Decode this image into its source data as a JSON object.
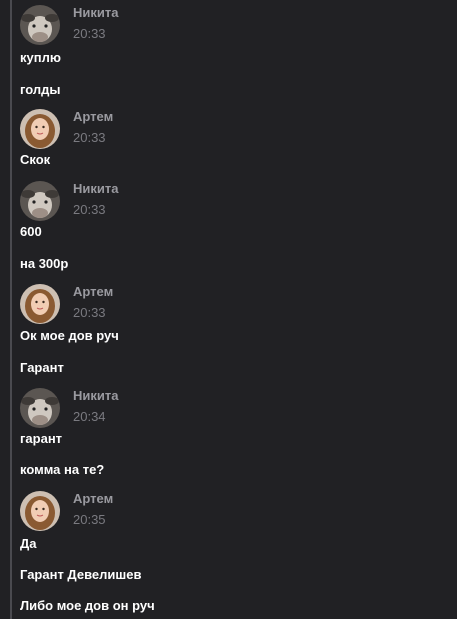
{
  "messages": [
    {
      "author": "Никита",
      "time": "20:33",
      "avatar": "cow-avatar",
      "lines": [
        "куплю",
        "голды"
      ]
    },
    {
      "author": "Артем",
      "time": "20:33",
      "avatar": "girl-avatar",
      "lines": [
        "Скок"
      ]
    },
    {
      "author": "Никита",
      "time": "20:33",
      "avatar": "cow-avatar",
      "lines": [
        "600",
        "на 300р"
      ]
    },
    {
      "author": "Артем",
      "time": "20:33",
      "avatar": "girl-avatar",
      "lines": [
        "Ок мое дов руч",
        "Гарант"
      ]
    },
    {
      "author": "Никита",
      "time": "20:34",
      "avatar": "cow-avatar",
      "lines": [
        "гарант",
        "комма на те?"
      ]
    },
    {
      "author": "Артем",
      "time": "20:35",
      "avatar": "girl-avatar",
      "lines": [
        "Да",
        "Гарант Девелишев",
        "Либо мое дов он руч"
      ]
    }
  ],
  "colors": {
    "background": "#212124",
    "author": "#9a9aa0",
    "time": "#7a7a80",
    "text": "#ffffff"
  }
}
